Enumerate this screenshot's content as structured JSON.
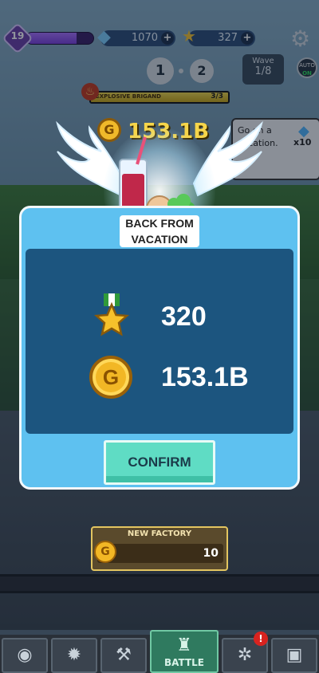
{
  "hud": {
    "level": "19",
    "xp_progress": 0.75,
    "gems": "1070",
    "medals": "327",
    "plus": "+"
  },
  "stage": {
    "current": "1",
    "next": "2",
    "wave_label": "Wave",
    "wave_value": "1/8",
    "auto_label": "AUTO",
    "auto_state": "ON"
  },
  "event": {
    "name": "EXPLOSIVE BRIGAND",
    "count": "3/3",
    "progress": 1.0
  },
  "gold_total": "153.1B",
  "vacation_card": {
    "text": "Go on a vacation.",
    "multiplier": "x10"
  },
  "dialog": {
    "title": "BACK FROM VACATION",
    "medal_reward": "320",
    "gold_reward": "153.1B",
    "coin_symbol": "G",
    "confirm_label": "CONFIRM"
  },
  "factory": {
    "title": "NEW FACTORY",
    "cost": "10"
  },
  "nav": {
    "battle_label": "BATTLE",
    "alert": "!"
  },
  "colors": {
    "dialog_bg": "#5ec1f0",
    "panel_bg": "#1c557f",
    "confirm_bg": "#5fdcc4",
    "gold": "#f2b725"
  }
}
